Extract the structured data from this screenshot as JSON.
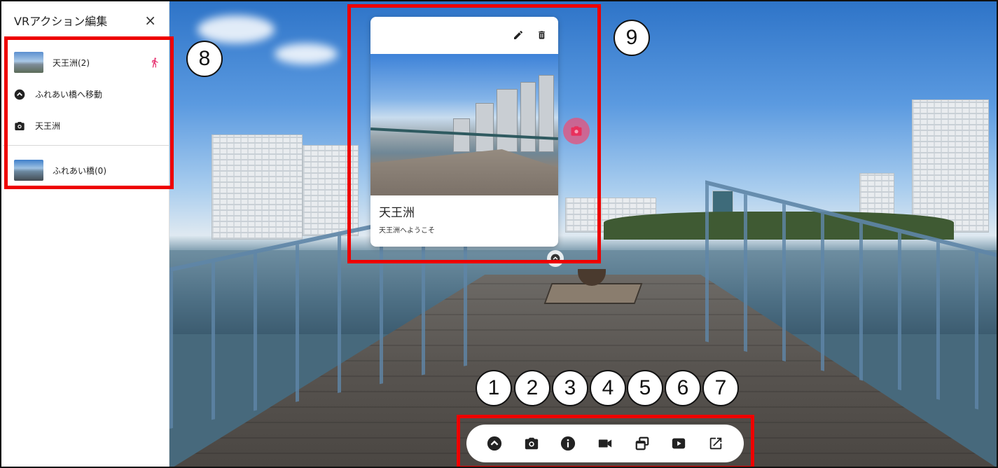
{
  "panel": {
    "title": "VRアクション編集",
    "close_label": "×",
    "scenes": [
      {
        "name": "天王洲(2)",
        "actions": [
          {
            "icon": "chevron-up-circle-icon",
            "label": "ふれあい橋へ移動"
          },
          {
            "icon": "camera-icon",
            "label": "天王洲"
          }
        ]
      },
      {
        "name": "ふれあい橋(0)"
      }
    ]
  },
  "card": {
    "title": "天王洲",
    "description": "天王洲へようこそ",
    "tools": [
      "pencil-icon",
      "trash-icon"
    ]
  },
  "toolbar": {
    "tools": [
      "move-icon",
      "camera-icon",
      "info-icon",
      "video-icon",
      "window-icon",
      "youtube-icon",
      "external-link-icon"
    ]
  },
  "annotations": {
    "toolbar_numbers": [
      "1",
      "2",
      "3",
      "4",
      "5",
      "6",
      "7"
    ],
    "panel_number": "8",
    "card_number": "9"
  },
  "colors": {
    "accent_pink": "#e8407a",
    "annotation_red": "#ee0000"
  }
}
